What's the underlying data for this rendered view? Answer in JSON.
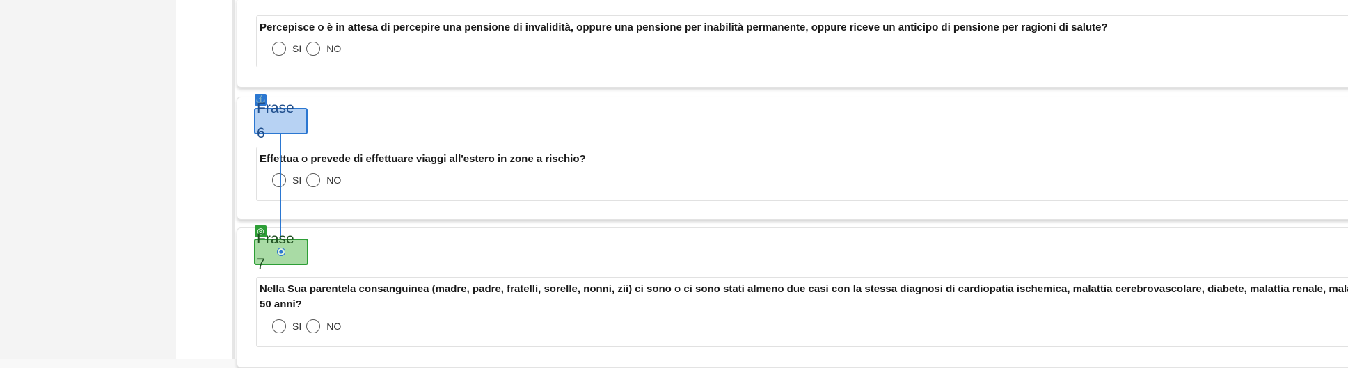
{
  "questions": [
    {
      "text": "Percepisce o è in attesa di percepire una pensione di invalidità, oppure una pensione per inabilità permanente, oppure riceve un anticipo di pensione per ragioni di salute?",
      "option_yes": "SI",
      "option_no": "NO"
    },
    {
      "text": "Effettua o prevede di effettuare viaggi all'estero in zone a rischio?",
      "option_yes": "SI",
      "option_no": "NO"
    },
    {
      "text": "Nella Sua parentela consanguinea (madre, padre, fratelli, sorelle, nonni, zii) ci sono o ci sono stati almeno due casi con la stessa diagnosi di cardiopatia ischemica, malattia cerebrovascolare, diabete, malattia renale, malattia cogn",
      "text_line2": "50 anni?",
      "option_yes": "SI",
      "option_no": "NO"
    }
  ],
  "labels": {
    "source": "Frase 6",
    "target": "Frase 7",
    "source_icon": "anchor-icon",
    "target_icon": "target-icon"
  },
  "colors": {
    "source_accent": "#2b77d1",
    "target_accent": "#2d9e36"
  }
}
